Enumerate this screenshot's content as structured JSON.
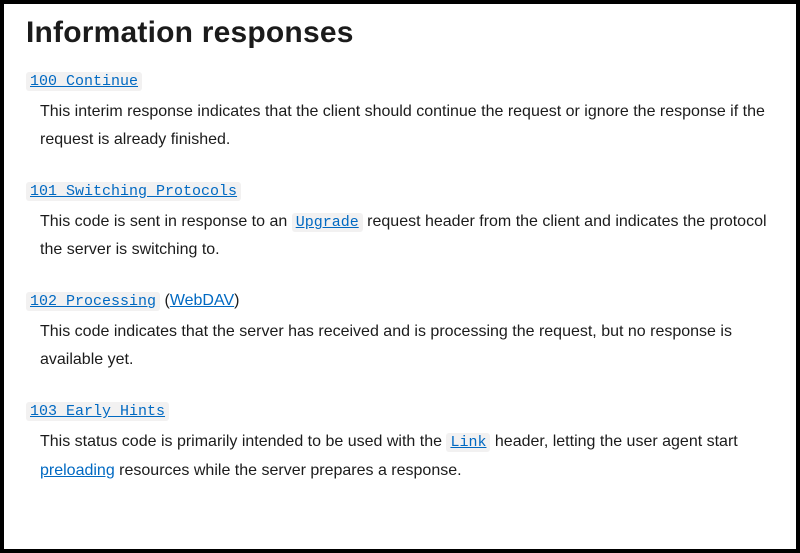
{
  "heading": "Information responses",
  "items": [
    {
      "title": "100 Continue",
      "title_link": true,
      "deprecated": false,
      "extra_prefix": "",
      "extra_link": "",
      "extra_suffix": "",
      "desc_pre": "This interim response indicates that the client should continue the request or ignore the response if the request is already finished.",
      "inline_code": "",
      "desc_post": "",
      "link2_text": "",
      "desc_tail": ""
    },
    {
      "title": "101 Switching Protocols",
      "title_link": true,
      "deprecated": false,
      "extra_prefix": "",
      "extra_link": "",
      "extra_suffix": "",
      "desc_pre": "This code is sent in response to an ",
      "inline_code": "Upgrade",
      "desc_post": " request header from the client and indicates the protocol the server is switching to.",
      "link2_text": "",
      "desc_tail": ""
    },
    {
      "title": "102 Processing",
      "title_link": true,
      "deprecated": true,
      "extra_prefix": " (",
      "extra_link": "WebDAV",
      "extra_suffix": ")",
      "desc_pre": "This code indicates that the server has received and is processing the request, but no response is available yet.",
      "inline_code": "",
      "desc_post": "",
      "link2_text": "",
      "desc_tail": ""
    },
    {
      "title": "103 Early Hints",
      "title_link": true,
      "deprecated": false,
      "extra_prefix": "",
      "extra_link": "",
      "extra_suffix": "",
      "desc_pre": "This status code is primarily intended to be used with the ",
      "inline_code": "Link",
      "desc_post": " header, letting the user agent start ",
      "link2_text": "preloading",
      "desc_tail": " resources while the server prepares a response."
    }
  ]
}
